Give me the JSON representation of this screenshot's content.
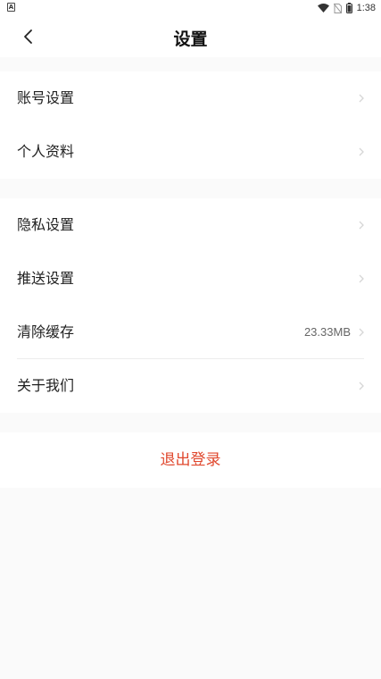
{
  "status_bar": {
    "app_icon": "A",
    "time": "1:38",
    "icons": [
      "wifi-icon",
      "no-sim-icon",
      "battery-icon"
    ]
  },
  "header": {
    "title": "设置",
    "back_icon": "chevron-left-icon"
  },
  "group1": {
    "items": [
      {
        "label": "账号设置"
      },
      {
        "label": "个人资料"
      }
    ]
  },
  "group2": {
    "items": [
      {
        "label": "隐私设置"
      },
      {
        "label": "推送设置"
      },
      {
        "label": "清除缓存",
        "value": "23.33MB"
      },
      {
        "label": "关于我们"
      }
    ]
  },
  "logout": {
    "label": "退出登录",
    "color": "#e0482e"
  },
  "colors": {
    "page_background": "#fafafa",
    "card_background": "#ffffff",
    "accent": "#e0482e"
  }
}
